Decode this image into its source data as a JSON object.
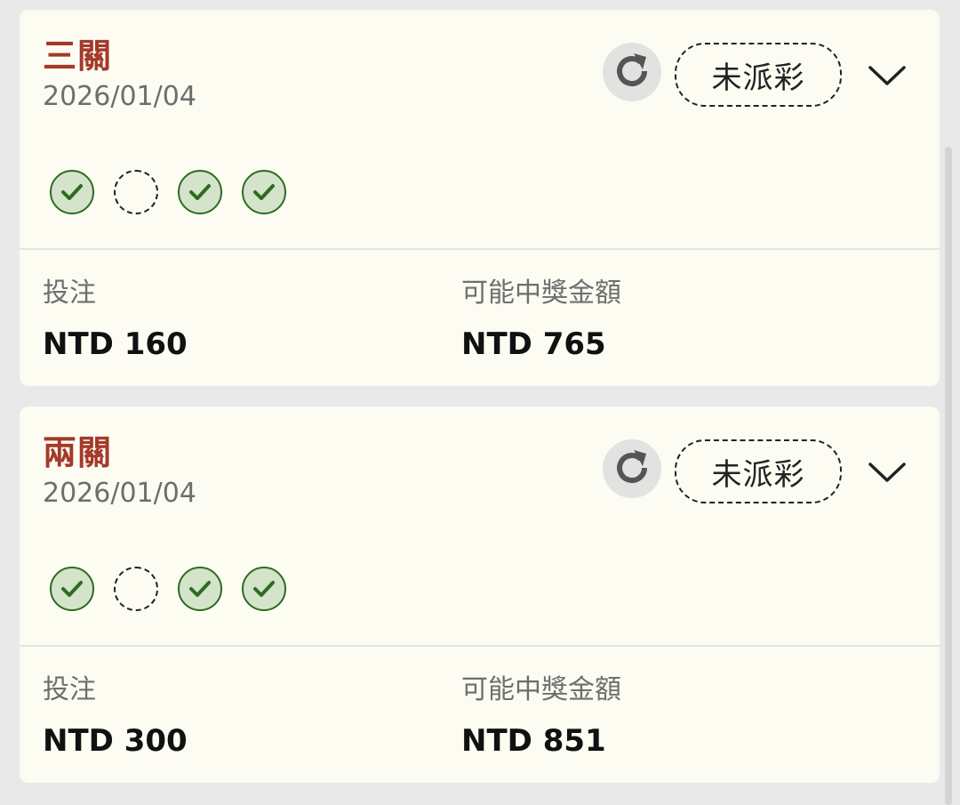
{
  "currency_prefix": "NTD",
  "colors": {
    "bet_type": "#a33a2a",
    "card_bg": "#fcfcf3",
    "page_bg": "#e9e9ea",
    "leg_won_fill": "#d3e4cb",
    "leg_won_stroke": "#2f6a22"
  },
  "icons": {
    "refresh": "refresh-icon",
    "expand": "chevron-down-icon",
    "leg_won": "check-circle-icon",
    "leg_pending": "dashed-circle-icon"
  },
  "bets": [
    {
      "bet_type": "三關",
      "date": "2026/01/04",
      "status": "未派彩",
      "legs": [
        "won",
        "pending",
        "won",
        "won"
      ],
      "stake_label": "投注",
      "stake_value": "NTD 160",
      "payout_label": "可能中獎金額",
      "payout_value": "NTD 765"
    },
    {
      "bet_type": "兩關",
      "date": "2026/01/04",
      "status": "未派彩",
      "legs": [
        "won",
        "pending",
        "won",
        "won"
      ],
      "stake_label": "投注",
      "stake_value": "NTD 300",
      "payout_label": "可能中獎金額",
      "payout_value": "NTD 851"
    }
  ]
}
